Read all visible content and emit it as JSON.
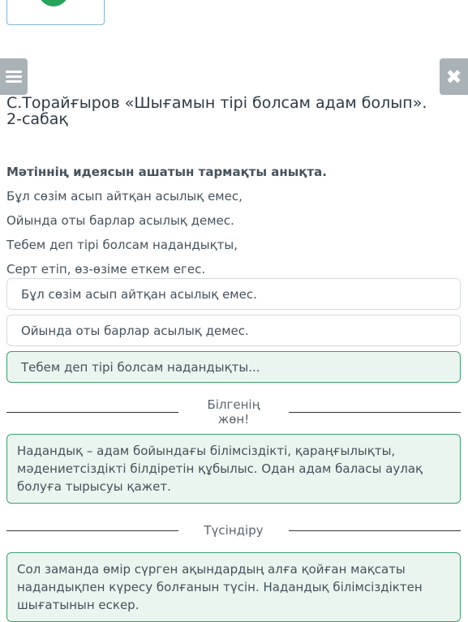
{
  "title": "С.Торайғыров «Шығамын тірі болсам адам болып». 2-сабақ",
  "question": "Мәтіннің идеясын ашатын тармақты анықта.",
  "poem": [
    "Бұл сөзім асып айтқан асылық емес,",
    "Ойында оты барлар асылық демес.",
    "Тебем деп тірі болсам надандықты,",
    "Серт етіп, өз-өзіме еткем егес."
  ],
  "options": [
    {
      "label": "Бұл сөзім асып айтқан асылық емес.",
      "selected": false
    },
    {
      "label": "Ойында оты барлар асылық демес.",
      "selected": false
    },
    {
      "label": "Тебем деп тірі болсам надандықты...",
      "selected": true
    }
  ],
  "knowledge": {
    "heading": "Білгенің жөн!",
    "text": "Надандық – адам бойындағы білімсіздікті, қараңғылықты, мәдениетсіздікті білдіретін құбылыс. Одан адам баласы аулақ болуға тырысуы қажет."
  },
  "explanation": {
    "heading": "Түсіндіру",
    "text": "Сол заманда өмір сүрген ақындардың алға қойған мақсаты надандықпен күресу болғанын түсін. Надандық білімсіздіктен шығатынын ескер."
  },
  "icons": {
    "menu": "menu-icon",
    "close": "close-icon"
  },
  "colors": {
    "accent": "#3f9c6d",
    "button_gray": "#a9b2b7"
  }
}
